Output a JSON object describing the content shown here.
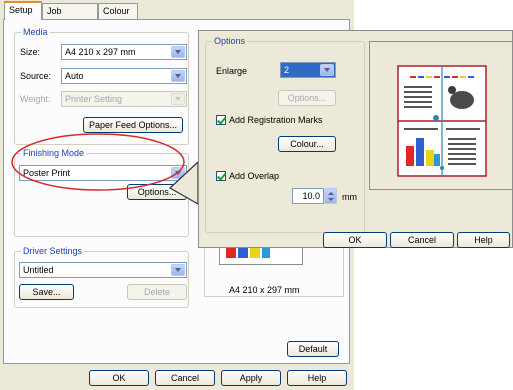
{
  "tabs": [
    {
      "label": "Setup",
      "active": true
    },
    {
      "label": "Job Options",
      "active": false
    },
    {
      "label": "Colour",
      "active": false
    }
  ],
  "media": {
    "title": "Media",
    "size_label": "Size:",
    "size_value": "A4 210 x 297 mm",
    "source_label": "Source:",
    "source_value": "Auto",
    "weight_label": "Weight:",
    "weight_value": "Printer Setting",
    "paper_feed_button": "Paper Feed Options..."
  },
  "finishing": {
    "title": "Finishing Mode",
    "value": "Poster Print",
    "options_button": "Options..."
  },
  "driver_settings": {
    "title": "Driver Settings",
    "value": "Untitled",
    "save_button": "Save...",
    "delete_button": "Delete"
  },
  "preview": {
    "caption": "A4 210 x 297 mm"
  },
  "default_button": "Default",
  "footer": {
    "ok": "OK",
    "cancel": "Cancel",
    "apply": "Apply",
    "help": "Help"
  },
  "options_dialog": {
    "title": "Options",
    "enlarge_label": "Enlarge",
    "enlarge_value": "2",
    "options_button": "Options...",
    "registration_label": "Add Registration Marks",
    "registration_checked": true,
    "colour_button": "Colour...",
    "overlap_label": "Add Overlap",
    "overlap_checked": true,
    "overlap_value": "10.0",
    "overlap_unit": "mm",
    "ok": "OK",
    "cancel": "Cancel",
    "help": "Help"
  },
  "colors": {
    "highlight_ellipse": "#d9262c",
    "group_title": "#1f43b4",
    "selection": "#316ac5"
  }
}
